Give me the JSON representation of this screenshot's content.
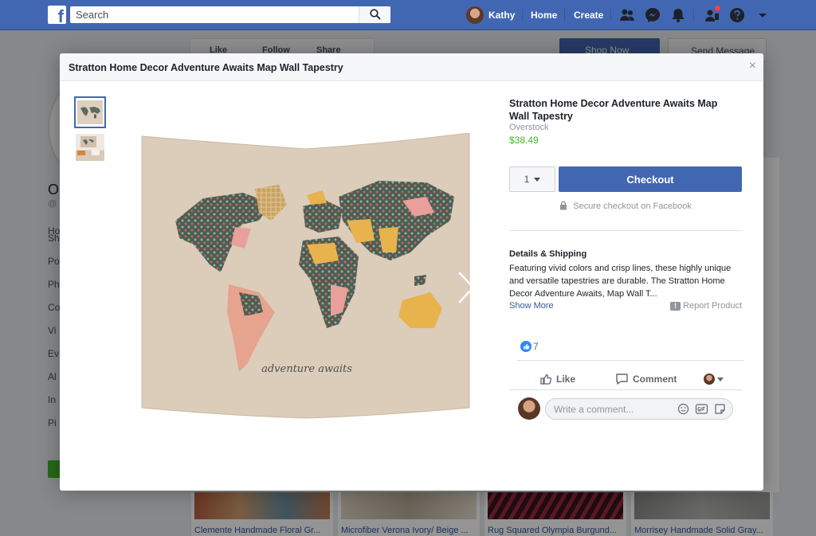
{
  "topbar": {
    "search_placeholder": "Search",
    "user_name": "Kathy",
    "nav_home": "Home",
    "nav_create": "Create"
  },
  "background": {
    "actions": {
      "like": "Like",
      "follow": "Follow",
      "share": "Share"
    },
    "shop_now": "Shop Now",
    "send_message": "Send Message",
    "page_initial": "O",
    "page_handle": "@",
    "sidebar": [
      "Ho",
      "Sh",
      "Po",
      "Ph",
      "Co",
      "Vi",
      "Ev",
      "Al",
      "In",
      "Pi"
    ],
    "products": [
      "Clemente Handmade Floral Gr...",
      "Microfiber Verona Ivory/ Beige ...",
      "Rug Squared Olympia Burgund...",
      "Morrisey Handmade Solid Gray..."
    ]
  },
  "modal": {
    "title": "Stratton Home Decor Adventure Awaits Map Wall Tapestry",
    "close_label": "×",
    "image_caption": "adventure awaits"
  },
  "product": {
    "title": "Stratton Home Decor Adventure Awaits Map Wall Tapestry",
    "seller": "Overstock",
    "price": "$38.49",
    "quantity": "1",
    "checkout_label": "Checkout",
    "secure_text": "Secure checkout on Facebook"
  },
  "details": {
    "heading": "Details & Shipping",
    "body": "Featuring vivid colors and crisp lines, these highly unique and versatile tapestries are durable. The Stratton Home Decor Adventure Awaits, Map Wall T...",
    "show_more": "Show More",
    "report": "Report Product"
  },
  "social": {
    "like_count": "7",
    "like_label": "Like",
    "comment_label": "Comment",
    "comment_placeholder": "Write a comment..."
  },
  "colors": {
    "facebook_blue": "#4267b2",
    "price_green": "#42b72a",
    "like_badge": "#2d88ff"
  },
  "icons": [
    "search-icon",
    "friends-icon",
    "messenger-icon",
    "bell-icon",
    "friend-requests-icon",
    "help-icon",
    "caret-down-icon",
    "close-icon",
    "lock-icon",
    "chevron-left-icon",
    "chevron-right-icon",
    "thumbs-up-icon",
    "comment-icon",
    "emoji-icon",
    "gif-icon",
    "sticker-icon"
  ]
}
